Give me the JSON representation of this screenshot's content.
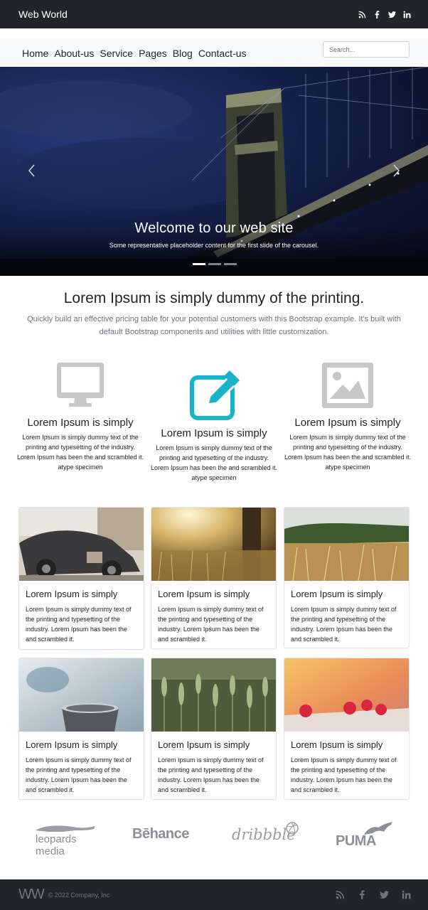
{
  "brand": "Web World",
  "social": [
    "rss-icon",
    "facebook-icon",
    "twitter-icon",
    "linkedin-icon"
  ],
  "nav": {
    "links": [
      "Home",
      "About-us",
      "Service",
      "Pages",
      "Blog",
      "Contact-us"
    ],
    "search_placeholder": "Search..."
  },
  "hero": {
    "title": "Welcome to our web site",
    "caption": "Some representative placeholder content for the first slide of the carousel.",
    "slide_count": 3,
    "active_slide": 1
  },
  "intro": {
    "title": "Lorem Ipsum is simply dummy of the printing.",
    "subtitle": "Quickly build an effective pricing table for your potential customers with this Bootstrap example. It's built with default Bootstrap components and utilities with little customization."
  },
  "features": [
    {
      "icon": "desktop-icon",
      "title": "Lorem Ipsum is simply",
      "text": "Lorem Ipsum is simply dummy text of the printing and typesetting of the industry. Lorem Ipsum has been the and scrambled it. atype specimen"
    },
    {
      "icon": "edit-icon",
      "title": "Lorem Ipsum is simply",
      "text": "Lorem Ipsum is simply dummy text of the printing and typesetting of the industry. Lorem Ipsum has been the and scrambled it. atype specimen"
    },
    {
      "icon": "image-icon",
      "title": "Lorem Ipsum is simply",
      "text": "Lorem Ipsum is simply dummy text of the printing and typesetting of the industry. Lorem Ipsum has been the and scrambled it. atype specimen"
    }
  ],
  "cards": [
    {
      "title": "Lorem Ipsum is simply",
      "text": "Lorem Ipsum is simply dummy text of the printing and typesetting of the industry. Lorem Ipsum has been the and scrambled it."
    },
    {
      "title": "Lorem Ipsum is simply",
      "text": "Lorem Ipsum is simply dummy text of the printing and typesetting of the industry. Lorem Ipsum has been the and scrambled it."
    },
    {
      "title": "Lorem Ipsum is simply",
      "text": "Lorem Ipsum is simply dummy text of the printing and typesetting of the industry. Lorem Ipsum has been the and scrambled it."
    },
    {
      "title": "Lorem Ipsum is simply",
      "text": "Lorem Ipsum is simply dummy text of the printing and typesetting of the industry. Lorem Ipsum has been the and scrambled it."
    },
    {
      "title": "Lorem Ipsum is simply",
      "text": "Lorem Ipsum is simply dummy text of the printing and typesetting of the industry. Lorem Ipsum has been the and scrambled it."
    },
    {
      "title": "Lorem Ipsum is simply",
      "text": "Lorem Ipsum is simply dummy text of the printing and typesetting of the industry. Lorem Ipsum has been the and scrambled it."
    }
  ],
  "partners": [
    "leopards media",
    "Bēhance",
    "dribbble",
    "PUMA"
  ],
  "footer": {
    "logo": "WW",
    "copyright": "© 2022 Company, Inc"
  },
  "colors": {
    "dark": "#212529",
    "light": "#f8f9fa",
    "accent": "#17b3c9",
    "muted": "#6c757d"
  }
}
